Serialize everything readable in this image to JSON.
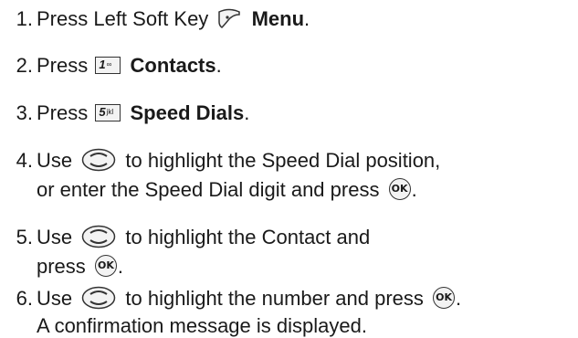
{
  "steps": [
    {
      "num": "1.",
      "lines": [
        {
          "pre": "Press Left Soft Key",
          "bold": "Menu",
          "post": "."
        }
      ],
      "icon": "soft-key-icon"
    },
    {
      "num": "2.",
      "lines": [
        {
          "pre": "Press",
          "key_digit": "1",
          "bold": "Contacts",
          "post": "."
        }
      ],
      "icon": "key-1-icon"
    },
    {
      "num": "3.",
      "lines": [
        {
          "pre": "Press",
          "key_digit": "5",
          "key_sub": "jkl",
          "bold": "Speed Dials",
          "post": "."
        }
      ],
      "icon": "key-5-icon"
    },
    {
      "num": "4.",
      "lines": [
        {
          "pre": "Use",
          "post": "to highlight the Speed Dial position,"
        },
        {
          "pre": "or enter the Speed Dial digit and press",
          "ok": "OK",
          "post": "."
        }
      ]
    },
    {
      "num": "5.",
      "lines": [
        {
          "pre": "Use",
          "post": "to highlight the Contact and"
        },
        {
          "pre": "press",
          "ok": "OK",
          "post": "."
        }
      ]
    },
    {
      "num": "6.",
      "lines": [
        {
          "pre": "Use",
          "post": "to highlight the number and press",
          "ok": "OK",
          "post2": "."
        },
        {
          "pre": "A confirmation message is displayed."
        }
      ]
    }
  ],
  "icons": {
    "nav_key": "directional-nav-key-icon",
    "ok_key": "ok-key-icon",
    "soft_key": "left-soft-key-icon"
  }
}
